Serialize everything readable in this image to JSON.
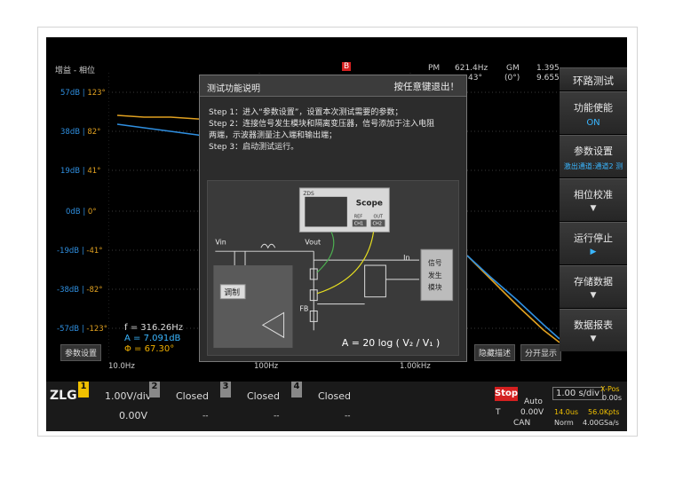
{
  "sidebar": {
    "items": [
      {
        "label": "环路测试",
        "value": "",
        "arrow": ""
      },
      {
        "label": "功能使能",
        "value": "ON",
        "arrow": ""
      },
      {
        "label": "参数设置",
        "value": "激出通道:通道2 测",
        "arrow": "◀"
      },
      {
        "label": "相位校准",
        "value": "",
        "arrow": "▼"
      },
      {
        "label": "运行停止",
        "value": "",
        "arrow": "▶"
      },
      {
        "label": "存储数据",
        "value": "",
        "arrow": "▼"
      },
      {
        "label": "数据报表",
        "value": "",
        "arrow": "▼"
      }
    ]
  },
  "plot": {
    "header_label": "增益 - 相位",
    "marker": "B",
    "pm_label": "PM",
    "pm_value": "621.4Hz",
    "pm_phase": "43°",
    "gm_label": "GM",
    "gm_phase": "(0°)",
    "gm_value1": "1.395",
    "gm_value2": "9.655",
    "gain_labels": [
      "57dB",
      "38dB",
      "19dB",
      "0dB",
      "-19dB",
      "-38dB",
      "-57dB"
    ],
    "phase_labels": [
      "123°",
      "82°",
      "41°",
      "0°",
      "-41°",
      "-82°",
      "-123°"
    ],
    "x_labels": [
      "10.0Hz",
      "100Hz",
      "1.00kHz"
    ],
    "measure_f": "f = 316.26Hz",
    "measure_a": "A = 7.091dB",
    "measure_phi": "Φ = 67.30°",
    "params_button": "参数设置",
    "hide_desc_button": "隐藏描述",
    "split_button": "分开显示",
    "gain_color": "#2f8fe0",
    "phase_color": "#e0a020"
  },
  "dialog": {
    "title": "测试功能说明",
    "exit_hint": "按任意键退出！",
    "steps": [
      "Step 1：进入“参数设置”，设置本次测试需要的参数；",
      "Step 2：连接信号发生模块和隔离变压器，信号添加于注入电阻",
      "两端，示波器测量注入端和输出端；",
      "Step 3：启动测试运行。"
    ],
    "diagram": {
      "brand": "ZDS",
      "scope": "Scope",
      "ref": "REF",
      "out": "OUT",
      "ch1": "CH1",
      "ch2": "CH2",
      "vin": "Vin",
      "vout": "Vout",
      "in": "In",
      "fb": "FB",
      "modulator": "调制",
      "siggen": [
        "信号",
        "发生",
        "模块"
      ],
      "formula": "A = 20 log ( V₂ / V₁ )"
    }
  },
  "bottom": {
    "logo": "ZLG",
    "ch1_num": "1",
    "ch1_volt": "1.00V/div",
    "ch1_offset": "0.00V",
    "ch2_num": "2",
    "ch2_status": "Closed",
    "ch3_num": "3",
    "ch3_status": "Closed",
    "ch4_num": "4",
    "ch4_status": "Closed",
    "dash": "--",
    "stop": "Stop",
    "auto": "Auto",
    "trig_letter": "T",
    "trig_level": "0.00V",
    "can": "CAN",
    "timebase": "1.00 s/div",
    "xpos_label": "X-Pos",
    "xpos_value": "0.00s",
    "sample_time": "14.0us",
    "sample_rate": "56.0Kpts",
    "mode": "Norm",
    "sps": "4.00GSa/s"
  }
}
